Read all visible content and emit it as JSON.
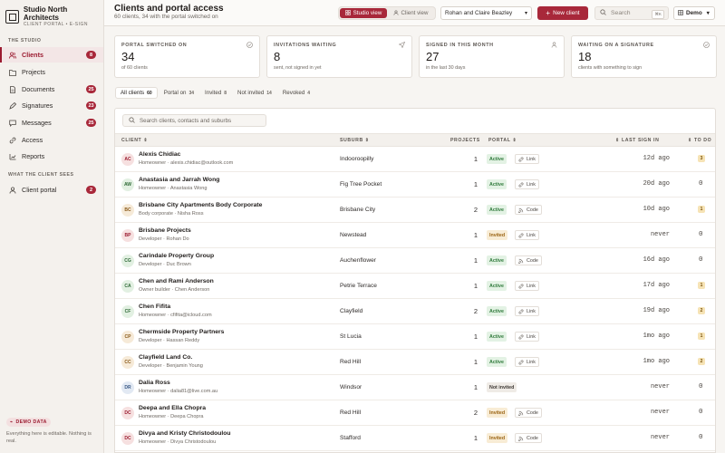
{
  "brand": {
    "name": "Studio North Architects",
    "subtitle": "CLIENT PORTAL • E-SIGN"
  },
  "sidebar": {
    "section_studio": "THE STUDIO",
    "items": [
      {
        "label": "Clients",
        "count": "8",
        "icon": "users-icon",
        "active": true
      },
      {
        "label": "Projects",
        "count": "",
        "icon": "folder-icon"
      },
      {
        "label": "Documents",
        "count": "25",
        "icon": "document-icon"
      },
      {
        "label": "Signatures",
        "count": "23",
        "icon": "pen-icon"
      },
      {
        "label": "Messages",
        "count": "25",
        "icon": "message-icon"
      },
      {
        "label": "Access",
        "count": "",
        "icon": "link-icon"
      },
      {
        "label": "Reports",
        "count": "",
        "icon": "chart-icon"
      }
    ],
    "section_client": "WHAT THE CLIENT SEES",
    "client_items": [
      {
        "label": "Client portal",
        "count": "2",
        "icon": "user-icon"
      }
    ],
    "demo_badge": "DEMO DATA",
    "demo_note": "Everything here is editable. Nothing is real."
  },
  "header": {
    "title": "Clients and portal access",
    "subtitle": "60 clients, 34 with the portal switched on",
    "studio_view": "Studio view",
    "client_view": "Client view",
    "client_select": "Rohan and Claire Beazley",
    "new_client": "New client",
    "search_placeholder": "Search",
    "search_kbd": "⌘K",
    "demo": "Demo"
  },
  "stats": [
    {
      "label": "PORTAL SWITCHED ON",
      "value": "34",
      "sub": "of 60 clients",
      "icon": "check-circle-icon"
    },
    {
      "label": "INVITATIONS WAITING",
      "value": "8",
      "sub": "sent, not signed in yet",
      "icon": "send-icon"
    },
    {
      "label": "SIGNED IN THIS MONTH",
      "value": "27",
      "sub": "in the last 30 days",
      "icon": "user-icon"
    },
    {
      "label": "WAITING ON A SIGNATURE",
      "value": "18",
      "sub": "clients with something to sign",
      "icon": "check-circle-icon"
    }
  ],
  "filters": [
    {
      "label": "All clients",
      "count": "60",
      "active": true
    },
    {
      "label": "Portal on",
      "count": "34"
    },
    {
      "label": "Invited",
      "count": "8"
    },
    {
      "label": "Not invited",
      "count": "14"
    },
    {
      "label": "Revoked",
      "count": "4"
    }
  ],
  "table": {
    "search_placeholder": "Search clients, contacts and suburbs",
    "columns": {
      "client": "CLIENT",
      "suburb": "SUBURB",
      "projects": "PROJECTS",
      "portal": "PORTAL",
      "last_sign_in": "LAST SIGN IN",
      "todo": "TO DO"
    },
    "rows": [
      {
        "initials": "AC",
        "name": "Alexis Chidiac",
        "meta": "Homeowner · alexis.chidiac@outlook.com",
        "suburb": "Indooroopilly",
        "projects": "1",
        "status": "Active",
        "access": "Link",
        "last": "12d ago",
        "todo": "3",
        "avatar_bg": "#f6e0e0",
        "avatar_fg": "#9b1b30"
      },
      {
        "initials": "AW",
        "name": "Anastasia and Jarrah Wong",
        "meta": "Homeowner · Anastasia Wong",
        "suburb": "Fig Tree Pocket",
        "projects": "1",
        "status": "Active",
        "access": "Link",
        "last": "20d ago",
        "todo": "0",
        "avatar_bg": "#e2f0e2",
        "avatar_fg": "#2f6a37"
      },
      {
        "initials": "BC",
        "name": "Brisbane City Apartments Body Corporate",
        "meta": "Body corporate · Nisha Ross",
        "suburb": "Brisbane City",
        "projects": "2",
        "status": "Active",
        "access": "Code",
        "last": "10d ago",
        "todo": "1",
        "avatar_bg": "#f6ead8",
        "avatar_fg": "#8a5a1a"
      },
      {
        "initials": "BP",
        "name": "Brisbane Projects",
        "meta": "Developer · Rohan Do",
        "suburb": "Newstead",
        "projects": "1",
        "status": "Invited",
        "access": "Link",
        "last": "never",
        "todo": "0",
        "avatar_bg": "#f6e0e0",
        "avatar_fg": "#9b1b30"
      },
      {
        "initials": "CG",
        "name": "Carindale Property Group",
        "meta": "Developer · Duc Brown",
        "suburb": "Auchenflower",
        "projects": "1",
        "status": "Active",
        "access": "Code",
        "last": "16d ago",
        "todo": "0",
        "avatar_bg": "#e2f0e2",
        "avatar_fg": "#2f6a37"
      },
      {
        "initials": "CA",
        "name": "Chen and Rami Anderson",
        "meta": "Owner builder · Chen Anderson",
        "suburb": "Petrie Terrace",
        "projects": "1",
        "status": "Active",
        "access": "Link",
        "last": "17d ago",
        "todo": "1",
        "avatar_bg": "#e2f0e2",
        "avatar_fg": "#2f6a37"
      },
      {
        "initials": "CF",
        "name": "Chen Fifita",
        "meta": "Homeowner · cfifita@icloud.com",
        "suburb": "Clayfield",
        "projects": "2",
        "status": "Active",
        "access": "Link",
        "last": "19d ago",
        "todo": "2",
        "avatar_bg": "#e2f0e2",
        "avatar_fg": "#2f6a37"
      },
      {
        "initials": "CP",
        "name": "Chermside Property Partners",
        "meta": "Developer · Hassan Reddy",
        "suburb": "St Lucia",
        "projects": "1",
        "status": "Active",
        "access": "Link",
        "last": "1mo ago",
        "todo": "1",
        "avatar_bg": "#f6ead8",
        "avatar_fg": "#8a5a1a"
      },
      {
        "initials": "CC",
        "name": "Clayfield Land Co.",
        "meta": "Developer · Benjamin Young",
        "suburb": "Red Hill",
        "projects": "1",
        "status": "Active",
        "access": "Link",
        "last": "1mo ago",
        "todo": "2",
        "avatar_bg": "#f6ead8",
        "avatar_fg": "#8a5a1a"
      },
      {
        "initials": "DR",
        "name": "Dalia Ross",
        "meta": "Homeowner · dalia81@live.com.au",
        "suburb": "Windsor",
        "projects": "1",
        "status": "Not invited",
        "access": "",
        "last": "never",
        "todo": "0",
        "avatar_bg": "#e2e9f3",
        "avatar_fg": "#3a5a86"
      },
      {
        "initials": "DC",
        "name": "Deepa and Ella Chopra",
        "meta": "Homeowner · Deepa Chopra",
        "suburb": "Red Hill",
        "projects": "2",
        "status": "Invited",
        "access": "Code",
        "last": "never",
        "todo": "0",
        "avatar_bg": "#f6e0e0",
        "avatar_fg": "#9b1b30"
      },
      {
        "initials": "DC",
        "name": "Divya and Kristy Christodoulou",
        "meta": "Homeowner · Divya Christodoulou",
        "suburb": "Stafford",
        "projects": "1",
        "status": "Invited",
        "access": "Code",
        "last": "never",
        "todo": "0",
        "avatar_bg": "#f6e0e0",
        "avatar_fg": "#9b1b30"
      }
    ]
  },
  "colors": {
    "accent": "#a8283a",
    "active_bg": "#e3f2e4",
    "invited_bg": "#f8ecd5"
  }
}
